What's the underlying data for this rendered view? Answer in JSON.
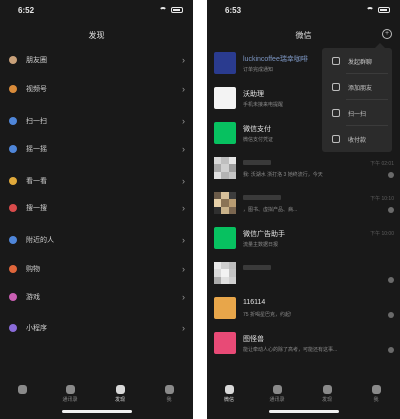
{
  "left": {
    "time": "6:52",
    "title": "发现",
    "menu": [
      {
        "label": "朋友圈",
        "color": "#c9a17a"
      },
      {
        "label": "视频号",
        "color": "#d98b3a"
      },
      {
        "label": "扫一扫",
        "color": "#4f86d9"
      },
      {
        "label": "摇一摇",
        "color": "#4f86d9"
      },
      {
        "label": "看一看",
        "color": "#e0a93b"
      },
      {
        "label": "搜一搜",
        "color": "#d94b4b"
      },
      {
        "label": "附近的人",
        "color": "#4f86d9"
      },
      {
        "label": "购物",
        "color": "#e0663b"
      },
      {
        "label": "游戏",
        "color": "#c95fb3"
      },
      {
        "label": "小程序",
        "color": "#8a6bd9"
      }
    ],
    "tabs": [
      {
        "label": ""
      },
      {
        "label": "通讯录"
      },
      {
        "label": "发现"
      },
      {
        "label": "我"
      }
    ]
  },
  "right": {
    "time": "6:53",
    "title": "微信",
    "chats": [
      {
        "name": "luckincoffee瑞幸咖啡",
        "preview": "订单完成通知",
        "time": "",
        "avatar": "#2a3b8f"
      },
      {
        "name": "沃助理",
        "preview": "手机未接来电提醒",
        "time": "",
        "avatar": "#f3f3f3"
      },
      {
        "name": "微信支付",
        "preview": "微信支付凭证",
        "time": "",
        "avatar": "#07c160"
      },
      {
        "name": "",
        "preview": "我: 沃湖水 浙打洛 3 她终流行，今天",
        "time": "下午 02:01",
        "avatar": "mosaic"
      },
      {
        "name": "",
        "preview": "，图书、虚拟产品、病...",
        "time": "下午 10:10",
        "avatar": "mosaic2"
      },
      {
        "name": "微信广告助手",
        "preview": "流量主数据日报",
        "time": "下午 10:00",
        "avatar": "#07c160"
      },
      {
        "name": "",
        "preview": "",
        "time": "",
        "avatar": "mosaic3"
      },
      {
        "name": "116114",
        "preview": "75 折喝星巴克，约起!",
        "time": "",
        "avatar": "#e8a64a"
      },
      {
        "name": "图怪兽",
        "preview": "能让牵动人心的除了高考，可能还有这事...",
        "time": "",
        "avatar": "#e84a76"
      }
    ],
    "popup": [
      {
        "label": "发起群聊"
      },
      {
        "label": "添加朋友"
      },
      {
        "label": "扫一扫"
      },
      {
        "label": "收付款"
      }
    ],
    "tabs": [
      {
        "label": "微信"
      },
      {
        "label": "通讯录"
      },
      {
        "label": "发现"
      },
      {
        "label": "我"
      }
    ]
  }
}
